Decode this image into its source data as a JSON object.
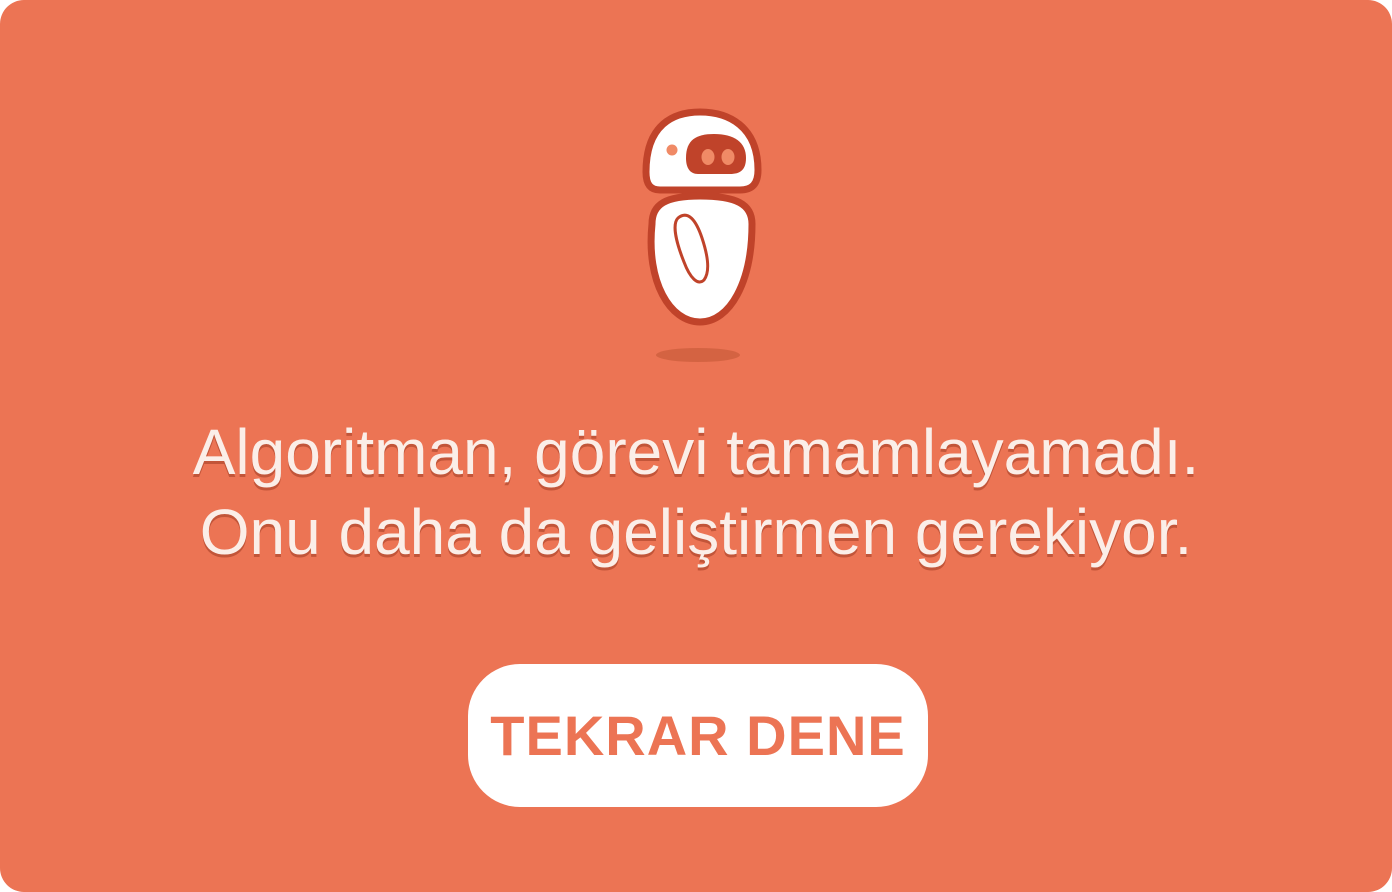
{
  "dialog": {
    "message_line_1": "Algoritman, görevi tamamlayamadı.",
    "message_line_2": "Onu daha da geliştirmen gerekiyor.",
    "retry_label": "TEKRAR DENE"
  },
  "mascot": {
    "icon": "robot-icon"
  },
  "colors": {
    "background": "#ec7454",
    "mascot_outline": "#c0432a",
    "button_background": "#ffffff",
    "button_text": "#ec7454",
    "message_text": "#fbeee8"
  }
}
